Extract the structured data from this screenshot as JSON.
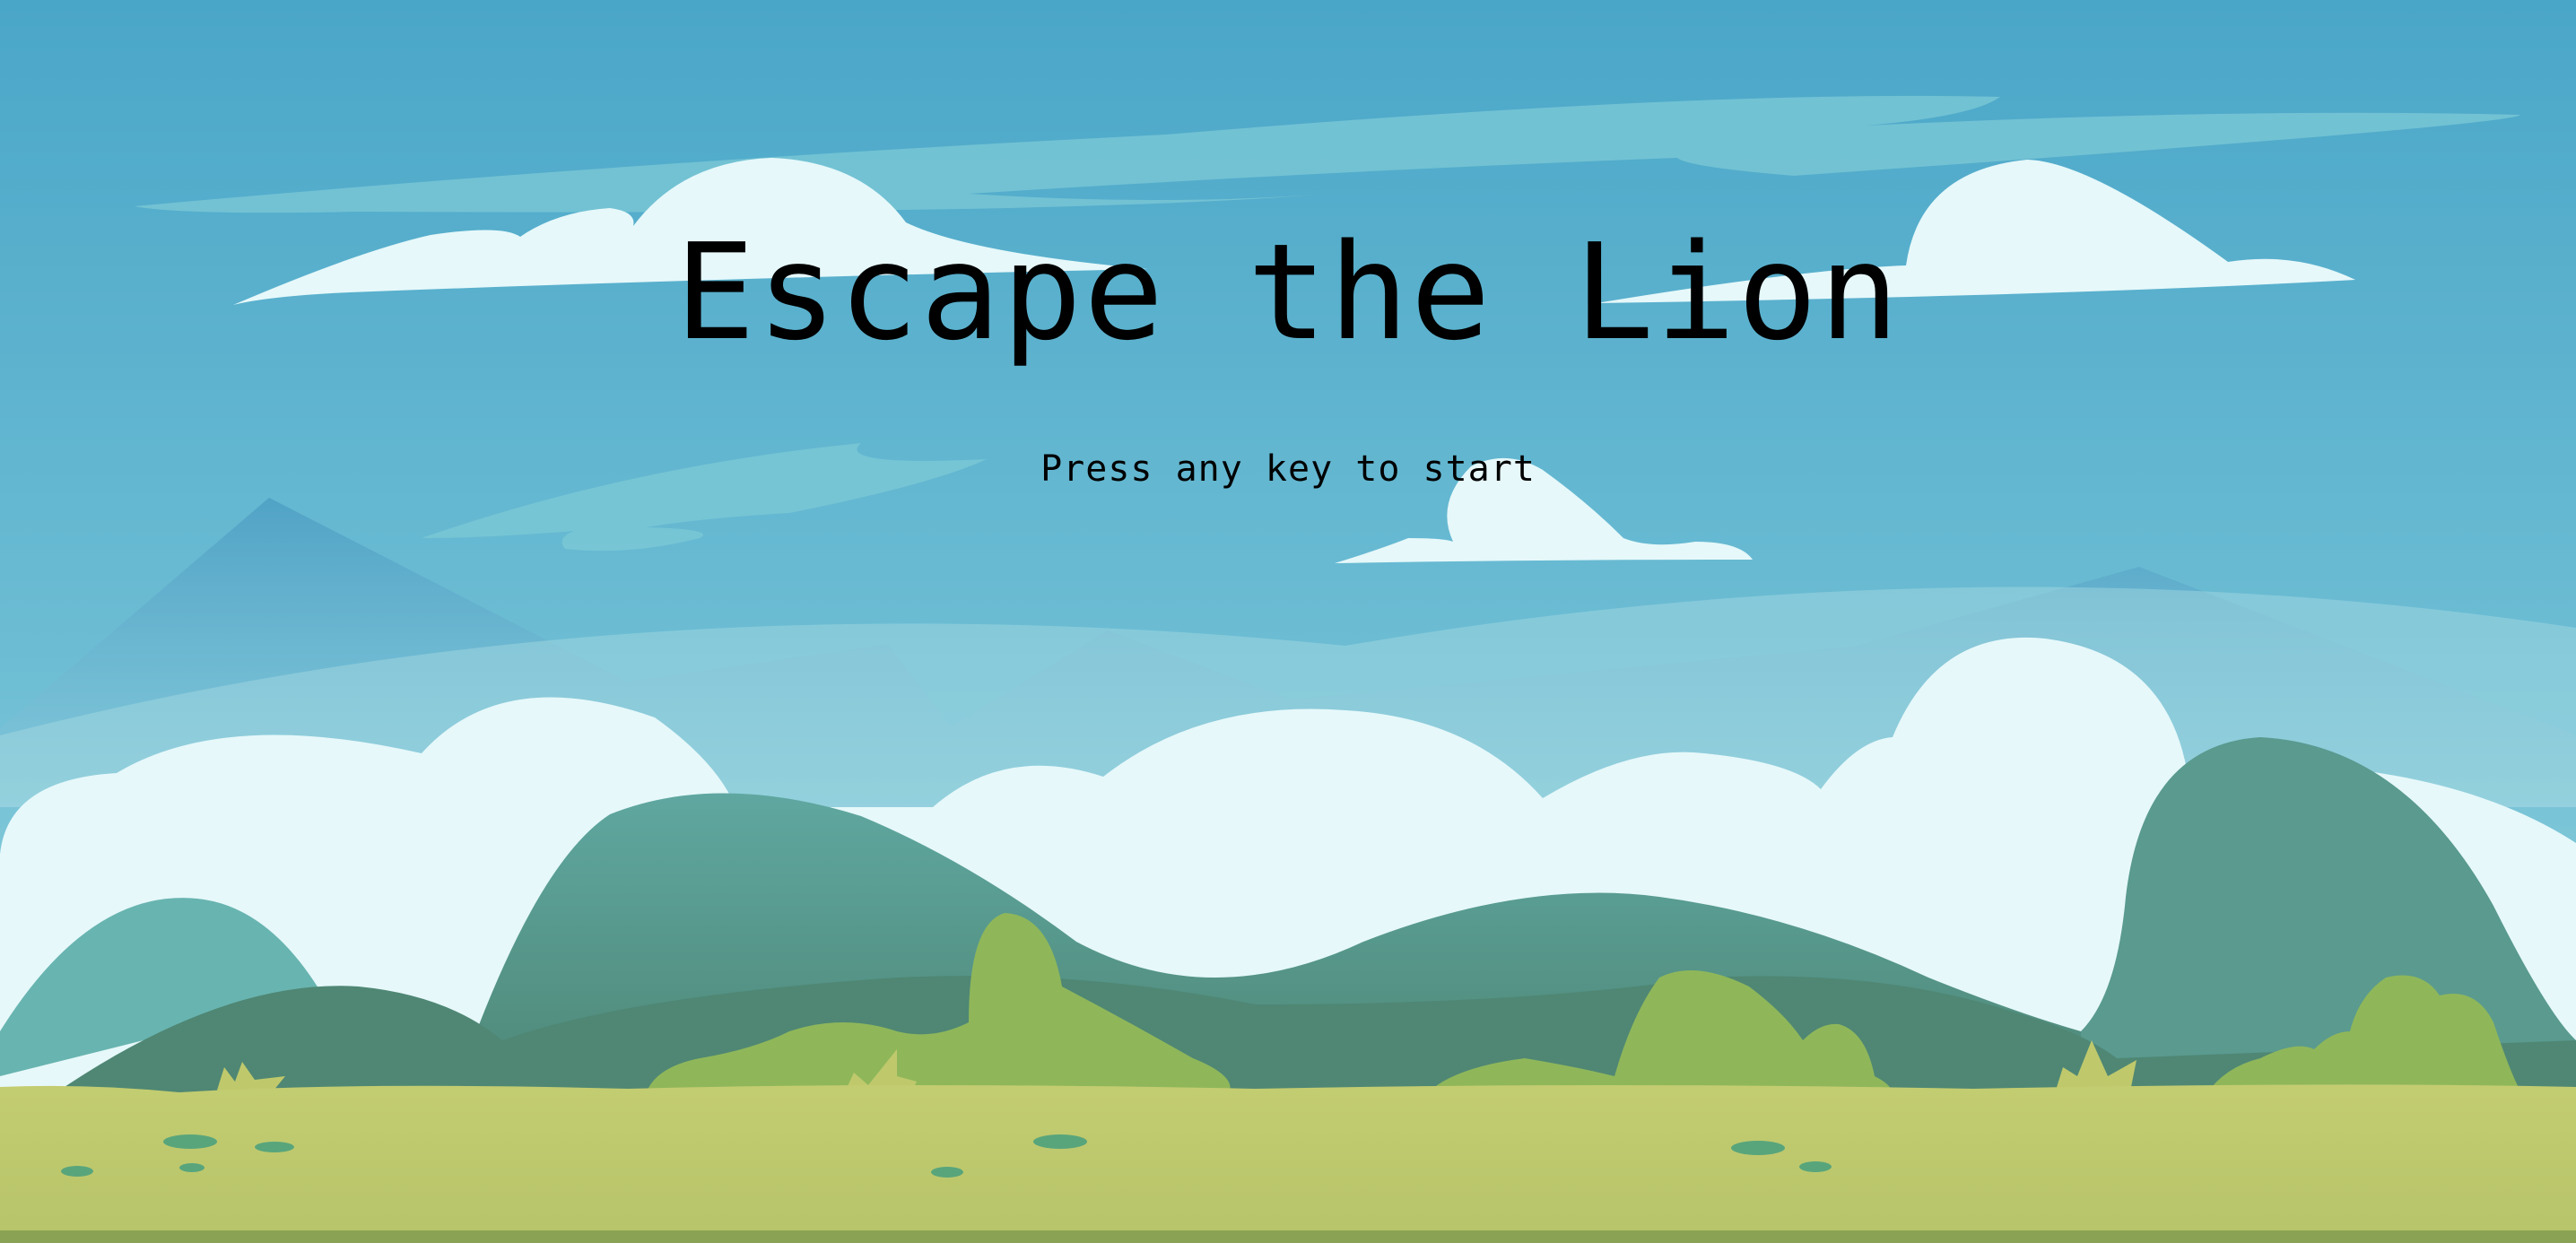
{
  "game": {
    "title": "Escape the Lion",
    "prompt": "Press any key to start"
  },
  "scene": {
    "background": "cartoon-sky-mountains-clouds-grassland",
    "colors": {
      "sky_top": "#4aa6c8",
      "sky_bottom": "#86cbd9",
      "cloud": "#e6f8fa",
      "far_mountain": "#5fa8c6",
      "hill_light": "#66b1ad",
      "hill_mid": "#5a9b96",
      "hill_dark": "#4e8571",
      "bush": "#8fb75a",
      "ground": "#bfc96c",
      "ground_shade": "#8aa253",
      "spot": "#58a57c"
    }
  }
}
